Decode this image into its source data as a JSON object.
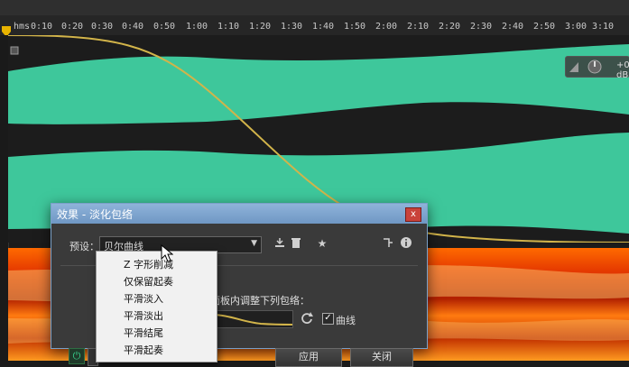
{
  "ruler": {
    "format_label": "hms",
    "ticks": [
      "0:10",
      "0:20",
      "0:30",
      "0:40",
      "0:50",
      "1:00",
      "1:10",
      "1:20",
      "1:30",
      "1:40",
      "1:50",
      "2:00",
      "2:10",
      "2:20",
      "2:30",
      "2:40",
      "2:50",
      "3:00",
      "3:10"
    ]
  },
  "hud": {
    "level_text": "+0 dB"
  },
  "dialog": {
    "title": "效果 - 淡化包络",
    "close_label": "x",
    "preset_label": "预设：",
    "preset_value": "贝尔曲线",
    "instruction_text": "面板内调整下列包络：",
    "curve_checkbox_label": "曲线",
    "curve_checked": true,
    "apply_label": "应用",
    "close_button_label": "关闭",
    "icons": [
      "save-preset-icon",
      "delete-preset-icon",
      "favorite-star-icon",
      "route-icon",
      "info-icon"
    ]
  },
  "preset_dropdown": {
    "items": [
      "Z 字形削减",
      "仅保留起奏",
      "平滑淡入",
      "平滑淡出",
      "平滑结尾",
      "平滑起奏"
    ]
  },
  "colors": {
    "waveform": "#3ec79b",
    "envelope": "#d2b44a",
    "dialog_title": "#7ea6d1",
    "spectral_hot": "#ff6a00"
  }
}
